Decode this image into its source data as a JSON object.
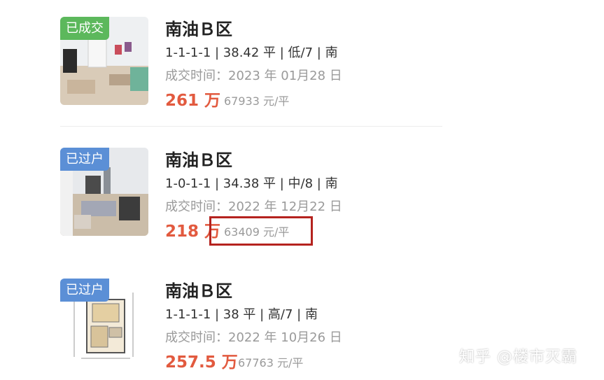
{
  "listings": [
    {
      "badge": "已成交",
      "badge_color": "#5cb85c",
      "title": "南油Ｂ区",
      "specs": "1-1-1-1 | 38.42 平 | 低/7 | 南",
      "deal_date": "成交时间：2023 年 01月28 日",
      "total_price": "261 万",
      "unit_price": "67933 元/平",
      "thumbnail": "living-room-photo"
    },
    {
      "badge": "已过户",
      "badge_color": "#5b8fd6",
      "title": "南油Ｂ区",
      "specs": "1-0-1-1 | 34.38 平 | 中/8 | 南",
      "deal_date": "成交时间：2022 年 12月22 日",
      "total_price": "218 万",
      "unit_price": "63409 元/平",
      "thumbnail": "living-room-photo"
    },
    {
      "badge": "已过户",
      "badge_color": "#5b8fd6",
      "title": "南油Ｂ区",
      "specs": "1-1-1-1 | 38 平 | 高/7 | 南",
      "deal_date": "成交时间：2022 年 10月26 日",
      "total_price": "257.5 万",
      "unit_price": "67763 元/平",
      "thumbnail": "floor-plan"
    }
  ],
  "watermark": "知乎 @楼市灭霸",
  "highlight_color": "#b5231f",
  "price_color": "#e25a3f"
}
